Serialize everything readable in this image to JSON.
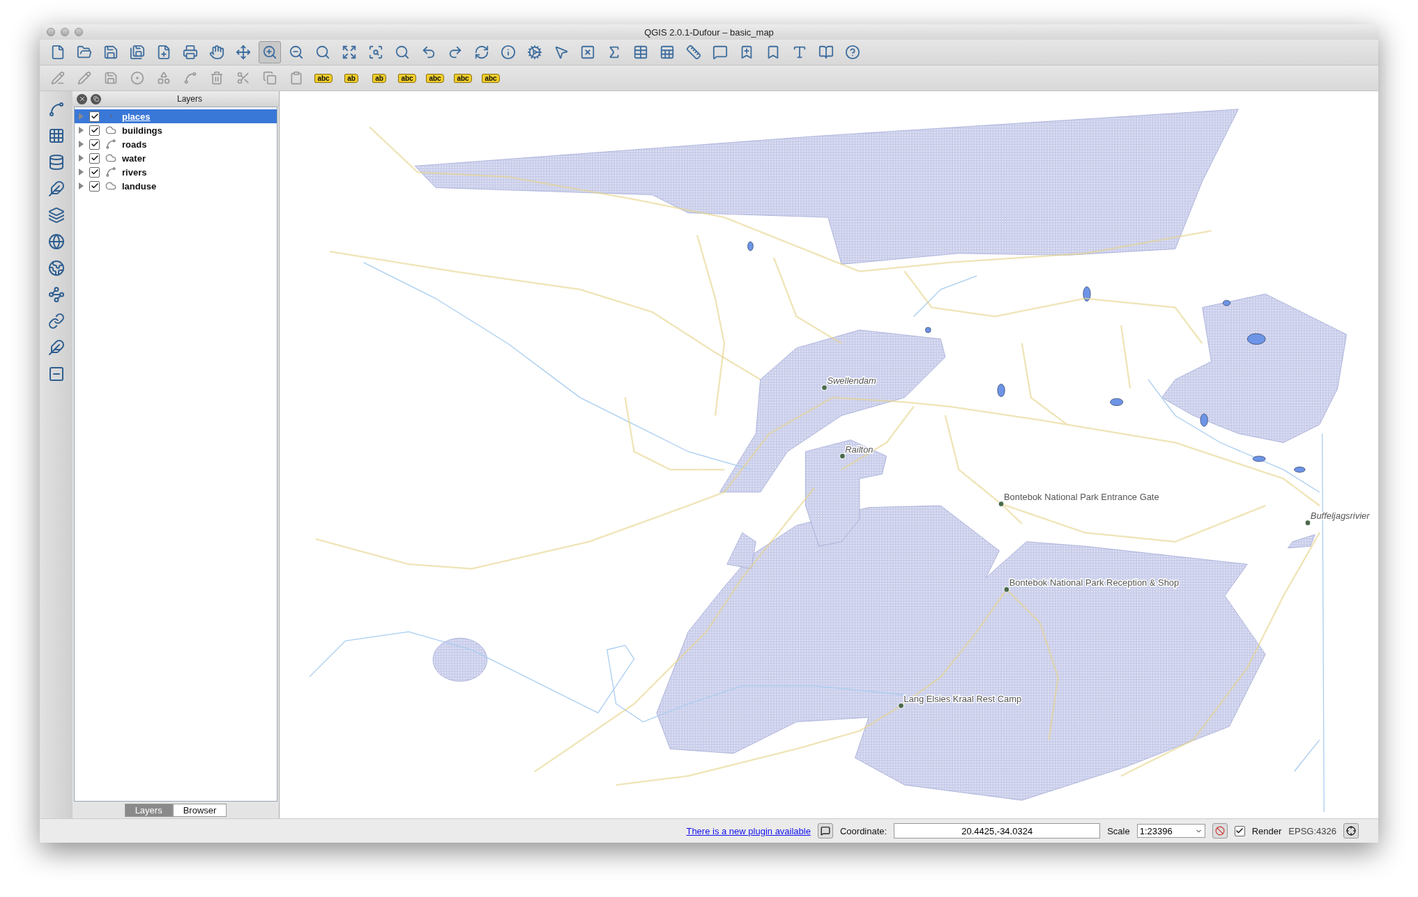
{
  "window": {
    "title": "QGIS 2.0.1-Dufour – basic_map"
  },
  "label_toolbar": [
    "abc",
    "ab",
    "ab",
    "abc",
    "abc",
    "abc",
    "abc"
  ],
  "layers_panel": {
    "title": "Layers",
    "layers": [
      {
        "name": "places",
        "kind": "point",
        "checked": true,
        "selected": true
      },
      {
        "name": "buildings",
        "kind": "polygon",
        "checked": true,
        "selected": false
      },
      {
        "name": "roads",
        "kind": "line",
        "checked": true,
        "selected": false
      },
      {
        "name": "water",
        "kind": "polygon",
        "checked": true,
        "selected": false
      },
      {
        "name": "rivers",
        "kind": "line",
        "checked": true,
        "selected": false
      },
      {
        "name": "landuse",
        "kind": "polygon",
        "checked": true,
        "selected": false
      }
    ],
    "tabs": [
      {
        "label": "Layers",
        "selected": true
      },
      {
        "label": "Browser",
        "selected": false
      }
    ]
  },
  "map": {
    "places": [
      {
        "name": "Swellendam",
        "kind": "town"
      },
      {
        "name": "Railton",
        "kind": "town"
      },
      {
        "name": "Bontebok National Park Entrance Gate",
        "kind": "poi"
      },
      {
        "name": "Bontebok National Park Reception & Shop",
        "kind": "poi"
      },
      {
        "name": "Lang Elsies Kraal Rest Camp",
        "kind": "poi"
      },
      {
        "name": "Buffeljagsrivier",
        "kind": "town"
      }
    ]
  },
  "status_bar": {
    "plugin_link": "There is a new plugin available",
    "coordinate_label": "Coordinate:",
    "coordinate": "20.4425,-34.0324",
    "scale_label": "Scale",
    "scale": "1:23396",
    "render_label": "Render",
    "render_checked": true,
    "crs": "EPSG:4326"
  }
}
